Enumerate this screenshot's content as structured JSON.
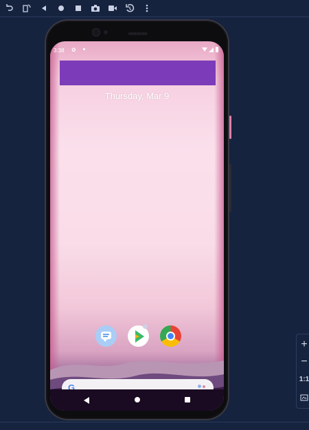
{
  "emulator_toolbar": {
    "icons": [
      "rotate-left-icon",
      "rotate-right-icon",
      "back-icon",
      "home-icon",
      "overview-icon",
      "screenshot-icon",
      "record-icon",
      "rewind-icon",
      "more-icon"
    ]
  },
  "phone": {
    "status_bar": {
      "time": "3:38"
    },
    "lockscreen": {
      "date": "Thursday, Mar 9"
    },
    "search": {
      "logo": "G"
    },
    "apps": [
      "messages",
      "play-store",
      "chrome"
    ]
  },
  "zoom_panel": {
    "zoom_in": "+",
    "zoom_out": "−",
    "actual_size": "1:1"
  },
  "colors": {
    "background": "#16233f",
    "accent_purple": "#7c3bb9"
  }
}
